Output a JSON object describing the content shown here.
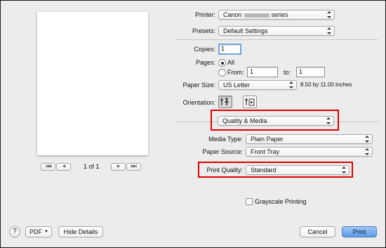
{
  "printer": {
    "label": "Printer:",
    "value_prefix": "Canon",
    "value_suffix": "series"
  },
  "presets": {
    "label": "Presets:",
    "value": "Default Settings"
  },
  "copies": {
    "label": "Copies:",
    "value": "1"
  },
  "pages": {
    "label": "Pages:",
    "all": "All",
    "from": "From:",
    "from_value": "1",
    "to": "to:",
    "to_value": "1",
    "selected": "All"
  },
  "paper_size": {
    "label": "Paper Size:",
    "value": "US Letter",
    "dimensions": "8.50 by 11.00 inches"
  },
  "orientation": {
    "label": "Orientation:",
    "options": [
      "portrait",
      "landscape"
    ],
    "selected": "portrait"
  },
  "section": {
    "value": "Quality & Media"
  },
  "media_type": {
    "label": "Media Type:",
    "value": "Plain Paper"
  },
  "paper_source": {
    "label": "Paper Source:",
    "value": "Front Tray"
  },
  "print_quality": {
    "label": "Print Quality:",
    "value": "Standard"
  },
  "grayscale": {
    "label": "Grayscale Printing",
    "checked": false
  },
  "pager": {
    "text": "1 of 1",
    "first": "|◀◀",
    "prev": "◀",
    "next": "▶",
    "last": "▶▶|"
  },
  "footer": {
    "help": "?",
    "pdf": "PDF",
    "hide_details": "Hide Details",
    "cancel": "Cancel",
    "print": "Print"
  },
  "colors": {
    "highlight": "#e00000",
    "default_button": "#5c9ae6",
    "focus_ring": "#6fa4df"
  }
}
